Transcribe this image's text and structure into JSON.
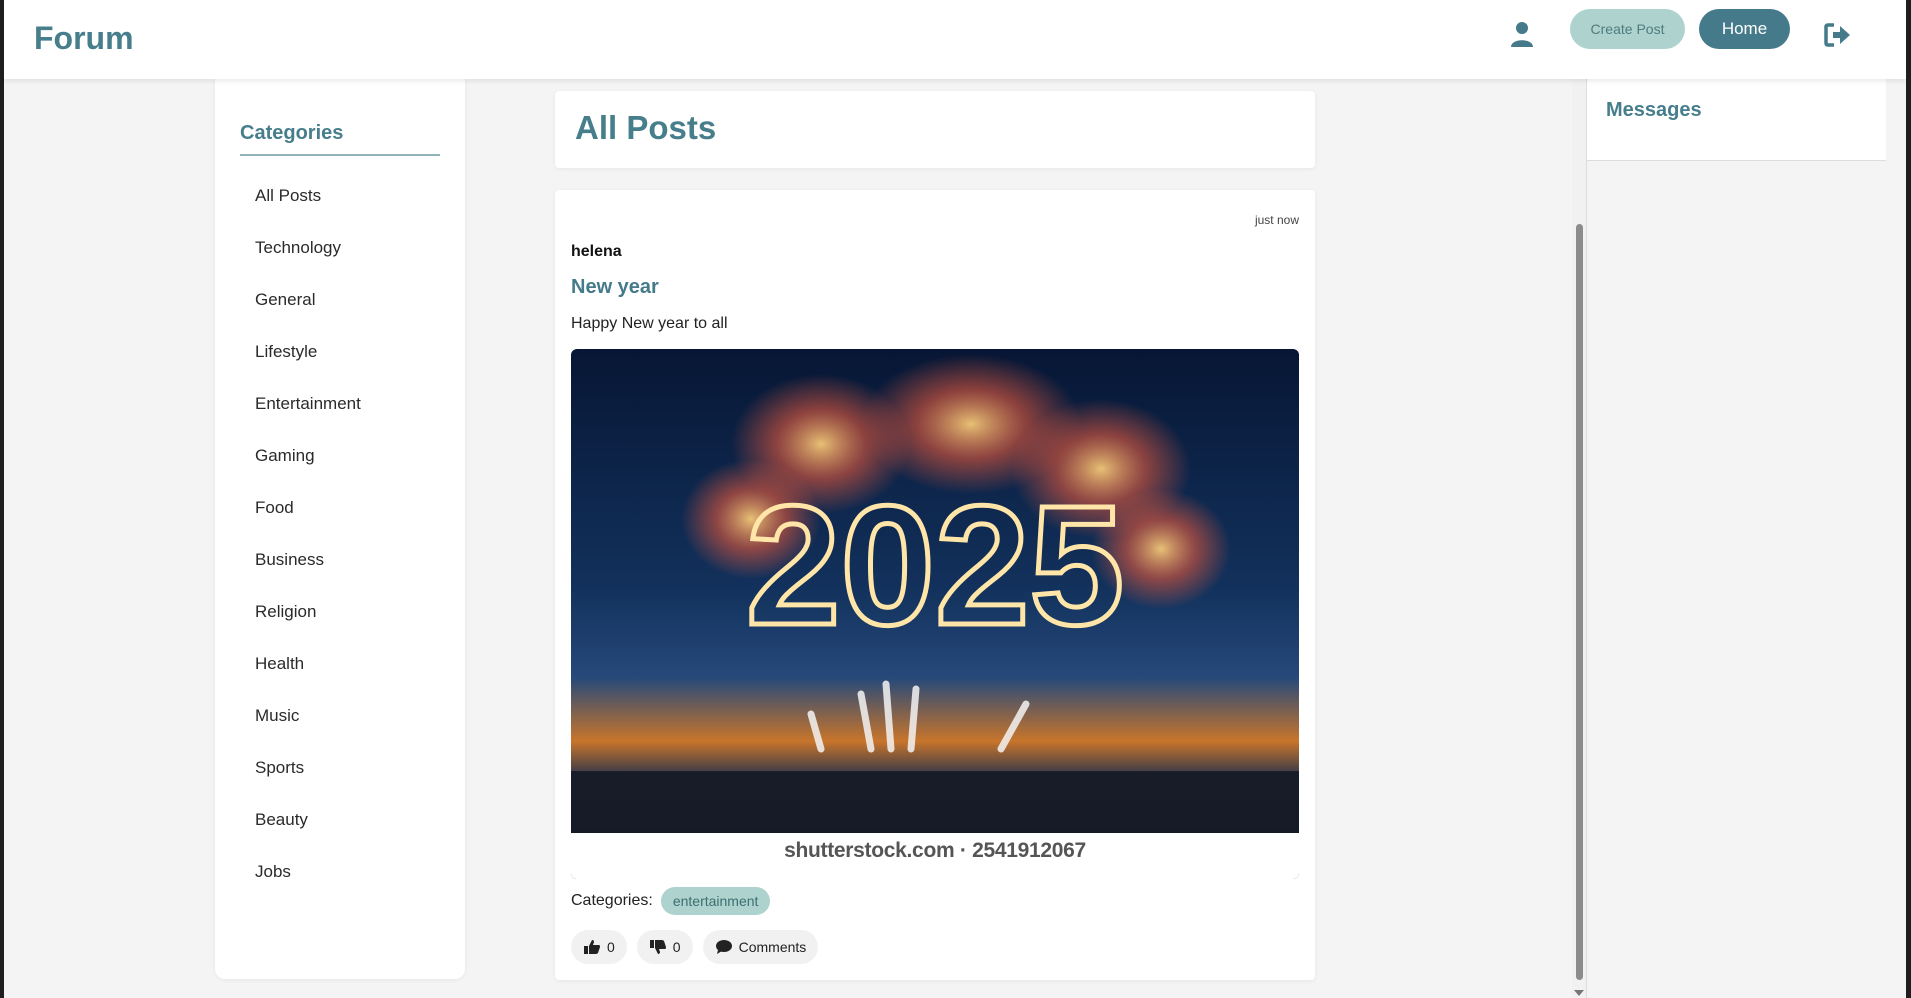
{
  "header": {
    "brand": "Forum",
    "create_post_label": "Create Post",
    "home_label": "Home",
    "icons": [
      "user-icon",
      "logout-icon"
    ]
  },
  "sidebar": {
    "title": "Categories",
    "items": [
      "All Posts",
      "Technology",
      "General",
      "Lifestyle",
      "Entertainment",
      "Gaming",
      "Food",
      "Business",
      "Religion",
      "Health",
      "Music",
      "Sports",
      "Beauty",
      "Jobs"
    ]
  },
  "main": {
    "page_title": "All Posts",
    "post": {
      "time": "just now",
      "author": "helena",
      "title": "New year",
      "body": "Happy New year to all",
      "image_caption": "shutterstock.com · 2541912067",
      "image_text": "2025",
      "categories_label": "Categories:",
      "categories": [
        "entertainment"
      ],
      "likes": "0",
      "dislikes": "0",
      "comments_label": "Comments"
    }
  },
  "messages": {
    "title": "Messages"
  },
  "colors": {
    "accent": "#467e8c",
    "home_button": "#457a8a",
    "create_button": "#aed3ce",
    "badge": "#aed3ce",
    "background": "#f4f4f4"
  }
}
